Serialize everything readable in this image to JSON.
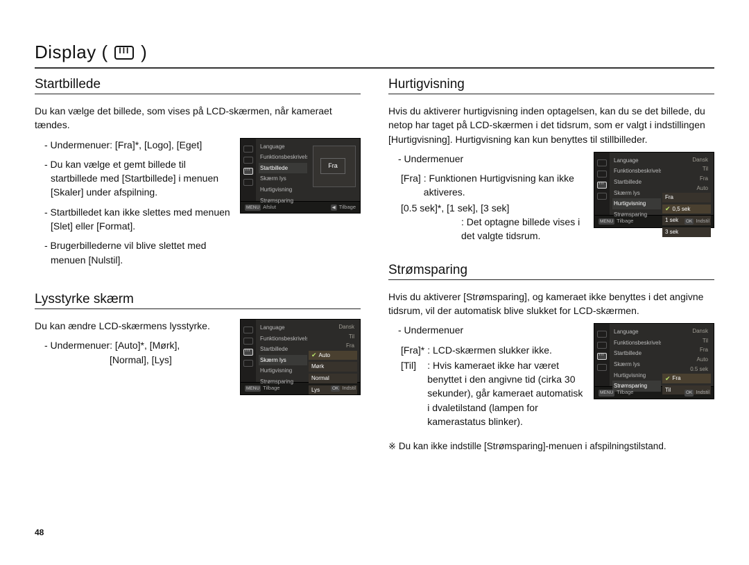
{
  "pageNumber": "48",
  "pageTitle": {
    "prefix": "Display (",
    "suffix": " )"
  },
  "camMenu": {
    "items": [
      "Language",
      "Funktionsbeskrivelse",
      "Startbillede",
      "Skærm lys",
      "Hurtigvisning",
      "Strømsparing"
    ],
    "values": [
      "Dansk",
      "Til",
      "Fra",
      "Auto",
      "0.5 sek",
      "Fra"
    ]
  },
  "foot": {
    "afslut_l": "MENU",
    "afslut_r": "Afslut",
    "tilbage_l": "◀",
    "tilbage_r": "Tilbage",
    "indstil_l": "OK",
    "indstil_r": "Indstil"
  },
  "s1": {
    "title": "Startbillede",
    "intro": "Du kan vælge det billede, som vises på LCD-skærmen, når kameraet tændes.",
    "b1": "- Undermenuer: [Fra]*, [Logo], [Eget]",
    "b2": "- Du kan vælge et gemt billede til startbillede med [Startbillede] i menuen [Skaler] under afspilning.",
    "b3": "- Startbilledet kan ikke slettes med menuen [Slet] eller [Format].",
    "b4": "- Brugerbillederne vil blive slettet med menuen [Nulstil].",
    "camSelected": "Startbillede",
    "camBox": "Fra"
  },
  "s2": {
    "title": "Lysstyrke skærm",
    "intro": "Du kan ændre LCD-skærmens lysstyrke.",
    "b1a": "- Undermenuer: [Auto]*, [Mørk],",
    "b1b": "[Normal], [Lys]",
    "camSelected": "Skærm lys",
    "opts": [
      "Auto",
      "Mørk",
      "Normal",
      "Lys"
    ]
  },
  "s3": {
    "title": "Hurtigvisning",
    "intro": "Hvis du aktiverer hurtigvisning inden optagelsen, kan du se det billede, du netop har taget på LCD-skærmen i det tidsrum, som er valgt i indstillingen [Hurtigvisning]. Hurtigvisning kan kun benyttes til stillbilleder.",
    "sub": "- Undermenuer",
    "row1k": "[Fra]",
    "row1v": ": Funktionen Hurtigvisning kan ikke aktiveres.",
    "row2k": "[0.5 sek]*, [1 sek], [3 sek]",
    "row2v": ": Det optagne billede vises i det valgte tidsrum.",
    "camSelected": "Hurtigvisning",
    "opts": [
      "Fra",
      "0,5 sek",
      "1 sek",
      "3 sek"
    ]
  },
  "s4": {
    "title": "Strømsparing",
    "intro": "Hvis du aktiverer [Strømsparing], og kameraet ikke benyttes i det angivne tidsrum, vil der automatisk blive slukket for LCD-skærmen.",
    "sub": "- Undermenuer",
    "row1k": "[Fra]*",
    "row1v": ": LCD-skærmen slukker ikke.",
    "row2k": "[Til]",
    "row2v": ": Hvis kameraet ikke har været benyttet i den angivne tid (cirka 30 sekunder), går kameraet automatisk i dvaletilstand (lampen for kamerastatus blinker).",
    "note": "Du kan ikke indstille [Strømsparing]-menuen i afspilningstilstand.",
    "camSelected": "Strømsparing",
    "opts": [
      "Fra",
      "Til"
    ]
  }
}
